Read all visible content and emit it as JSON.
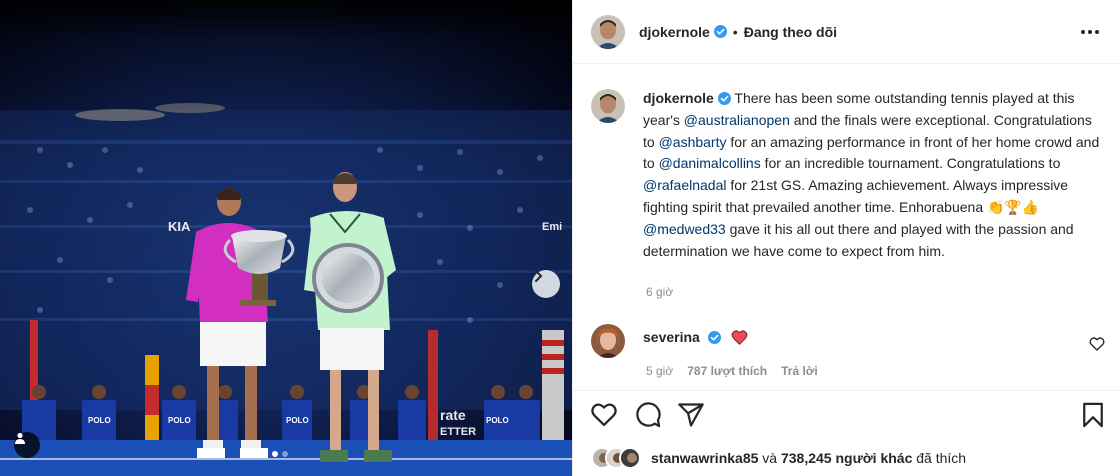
{
  "post": {
    "username": "djokernole",
    "header_separator": "•",
    "follow_status": "Đang theo dõi",
    "caption": {
      "username": "djokernole",
      "t1": " There has been some outstanding tennis played at this year's ",
      "m1": "@australianopen",
      "t2": " and the finals were exceptional. Congratulations to ",
      "m2": "@ashbarty",
      "t3": " for an amazing performance in front of her home crowd and to ",
      "m3": "@danimalcollins",
      "t4": " for an incredible tournament. Congratulations to ",
      "m4": "@rafaelnadal",
      "t5": " for 21st GS. Amazing achievement. Always impressive fighting spirit that prevailed another time. Enhorabuena ",
      "emoji": "👏🏆👍",
      "t6": " ",
      "m5": "@medwed33",
      "t7": " gave it his all out there and played with the passion and determination we have come to expect from him.",
      "time": "6 giờ"
    },
    "comment": {
      "username": "severina",
      "time": "5 giờ",
      "likes": "787 lượt thích",
      "reply": "Trả lời"
    },
    "likes_summary": {
      "first_user": "stanwawrinka85",
      "and": " và ",
      "others": "738,245 người khác",
      "suffix": " đã thích"
    },
    "colors": {
      "verified": "#3897f0",
      "mention": "#00376b",
      "heart": "#ed4956"
    }
  }
}
